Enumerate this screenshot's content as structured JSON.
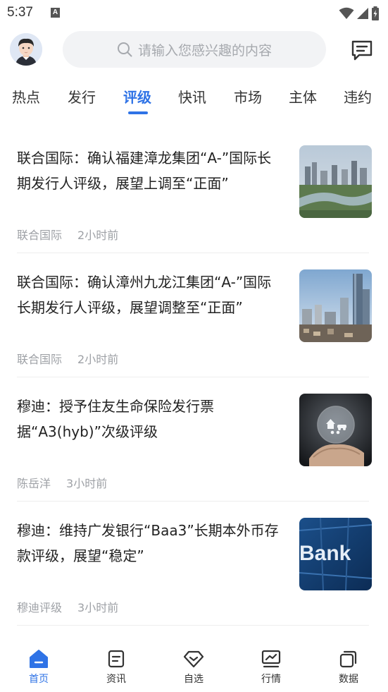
{
  "status_bar": {
    "time": "5:37",
    "icons": [
      "keyboard-a-icon",
      "wifi-icon",
      "signal-icon",
      "battery-icon"
    ]
  },
  "header": {
    "search_placeholder": "请输入您感兴趣的内容",
    "search_icon": "search-icon",
    "message_icon": "message-icon"
  },
  "tabs": [
    {
      "label": "热点",
      "active": false
    },
    {
      "label": "发行",
      "active": false
    },
    {
      "label": "评级",
      "active": true
    },
    {
      "label": "快讯",
      "active": false
    },
    {
      "label": "市场",
      "active": false
    },
    {
      "label": "主体",
      "active": false
    },
    {
      "label": "违约",
      "active": false
    }
  ],
  "news": [
    {
      "title": "联合国际：确认福建漳龙集团“A-”国际长期发行人评级，展望上调至“正面”",
      "source": "联合国际",
      "time": "2小时前",
      "thumb": "city-river"
    },
    {
      "title": "联合国际：确认漳州九龙江集团“A-”国际长期发行人评级，展望调整至“正面”",
      "source": "联合国际",
      "time": "2小时前",
      "thumb": "city-skyline"
    },
    {
      "title": "穆迪：授予住友生命保险发行票据“A3(hyb)”次级评级",
      "source": "陈岳洋",
      "time": "3小时前",
      "thumb": "insurance-hand"
    },
    {
      "title": "穆迪：维持广发银行“Baa3”长期本外币存款评级，展望“稳定”",
      "source": "穆迪评级",
      "time": "3小时前",
      "thumb": "bank-sign",
      "thumb_text": "Bank"
    }
  ],
  "bottom_nav": [
    {
      "label": "首页",
      "icon": "home-icon",
      "active": true
    },
    {
      "label": "资讯",
      "icon": "news-icon",
      "active": false
    },
    {
      "label": "自选",
      "icon": "diamond-icon",
      "active": false
    },
    {
      "label": "行情",
      "icon": "chart-icon",
      "active": false
    },
    {
      "label": "数据",
      "icon": "stack-icon",
      "active": false
    }
  ],
  "colors": {
    "accent": "#2f73e6",
    "text": "#222222",
    "muted": "#9ea1a6",
    "search_bg": "#f2f3f5"
  }
}
